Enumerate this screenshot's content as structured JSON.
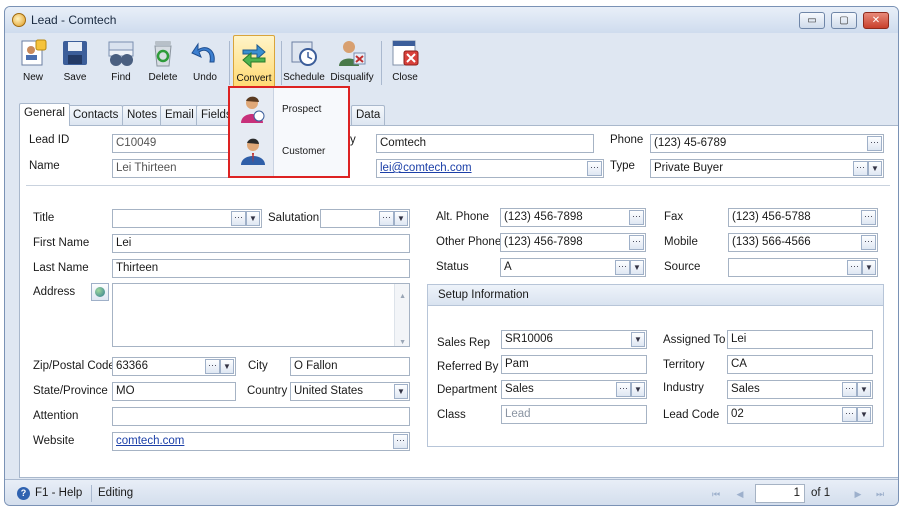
{
  "window": {
    "title": "Lead - Comtech",
    "min": "▭",
    "max": "▢",
    "close": "✕"
  },
  "toolbar": {
    "new": "New",
    "save": "Save",
    "find": "Find",
    "delete": "Delete",
    "undo": "Undo",
    "convert": "Convert",
    "schedule": "Schedule",
    "disqualify": "Disqualify",
    "close": "Close"
  },
  "convert_menu": {
    "prospect": "Prospect",
    "customer": "Customer"
  },
  "tabs": [
    "General",
    "Contacts",
    "Notes",
    "Email",
    "Fields",
    "Data"
  ],
  "header": {
    "lead_id_label": "Lead ID",
    "lead_id": "C10049",
    "name_label": "Name",
    "name": "Lei Thirteen",
    "company_label": "y",
    "company": "Comtech",
    "email": "lei@comtech.com",
    "phone_label": "Phone",
    "phone": "(123) 45-6789",
    "type_label": "Type",
    "type": "Private Buyer"
  },
  "person": {
    "title_label": "Title",
    "title": "",
    "salutation_label": "Salutation",
    "salutation": "",
    "first_name_label": "First Name",
    "first_name": "Lei",
    "last_name_label": "Last Name",
    "last_name": "Thirteen",
    "address_label": "Address",
    "address": "",
    "zip_label": "Zip/Postal Code",
    "zip": "63366",
    "city_label": "City",
    "city": "O Fallon",
    "state_label": "State/Province",
    "state": "MO",
    "country_label": "Country",
    "country": "United States",
    "attention_label": "Attention",
    "attention": "",
    "website_label": "Website",
    "website": "comtech.com"
  },
  "contact": {
    "alt_phone_label": "Alt. Phone",
    "alt_phone": "(123) 456-7898",
    "other_phone_label": "Other Phone",
    "other_phone": "(123) 456-7898",
    "status_label": "Status",
    "status": "A",
    "fax_label": "Fax",
    "fax": "(123) 456-5788",
    "mobile_label": "Mobile",
    "mobile": "(133) 566-4566",
    "source_label": "Source",
    "source": ""
  },
  "setup": {
    "header": "Setup Information",
    "sales_rep_label": "Sales Rep",
    "sales_rep": "SR10006",
    "referred_by_label": "Referred By",
    "referred_by": "Pam",
    "department_label": "Department",
    "department": "Sales",
    "class_label": "Class",
    "class": "Lead",
    "assigned_to_label": "Assigned To",
    "assigned_to": "Lei",
    "territory_label": "Territory",
    "territory": "CA",
    "industry_label": "Industry",
    "industry": "Sales",
    "lead_code_label": "Lead Code",
    "lead_code": "02"
  },
  "statusbar": {
    "help": "F1 - Help",
    "mode": "Editing",
    "page": "1",
    "of": "of 1"
  },
  "colors": {
    "highlight_border": "#dd2222",
    "window_bg": "#dfe7f2",
    "link": "#1b3fa8"
  }
}
